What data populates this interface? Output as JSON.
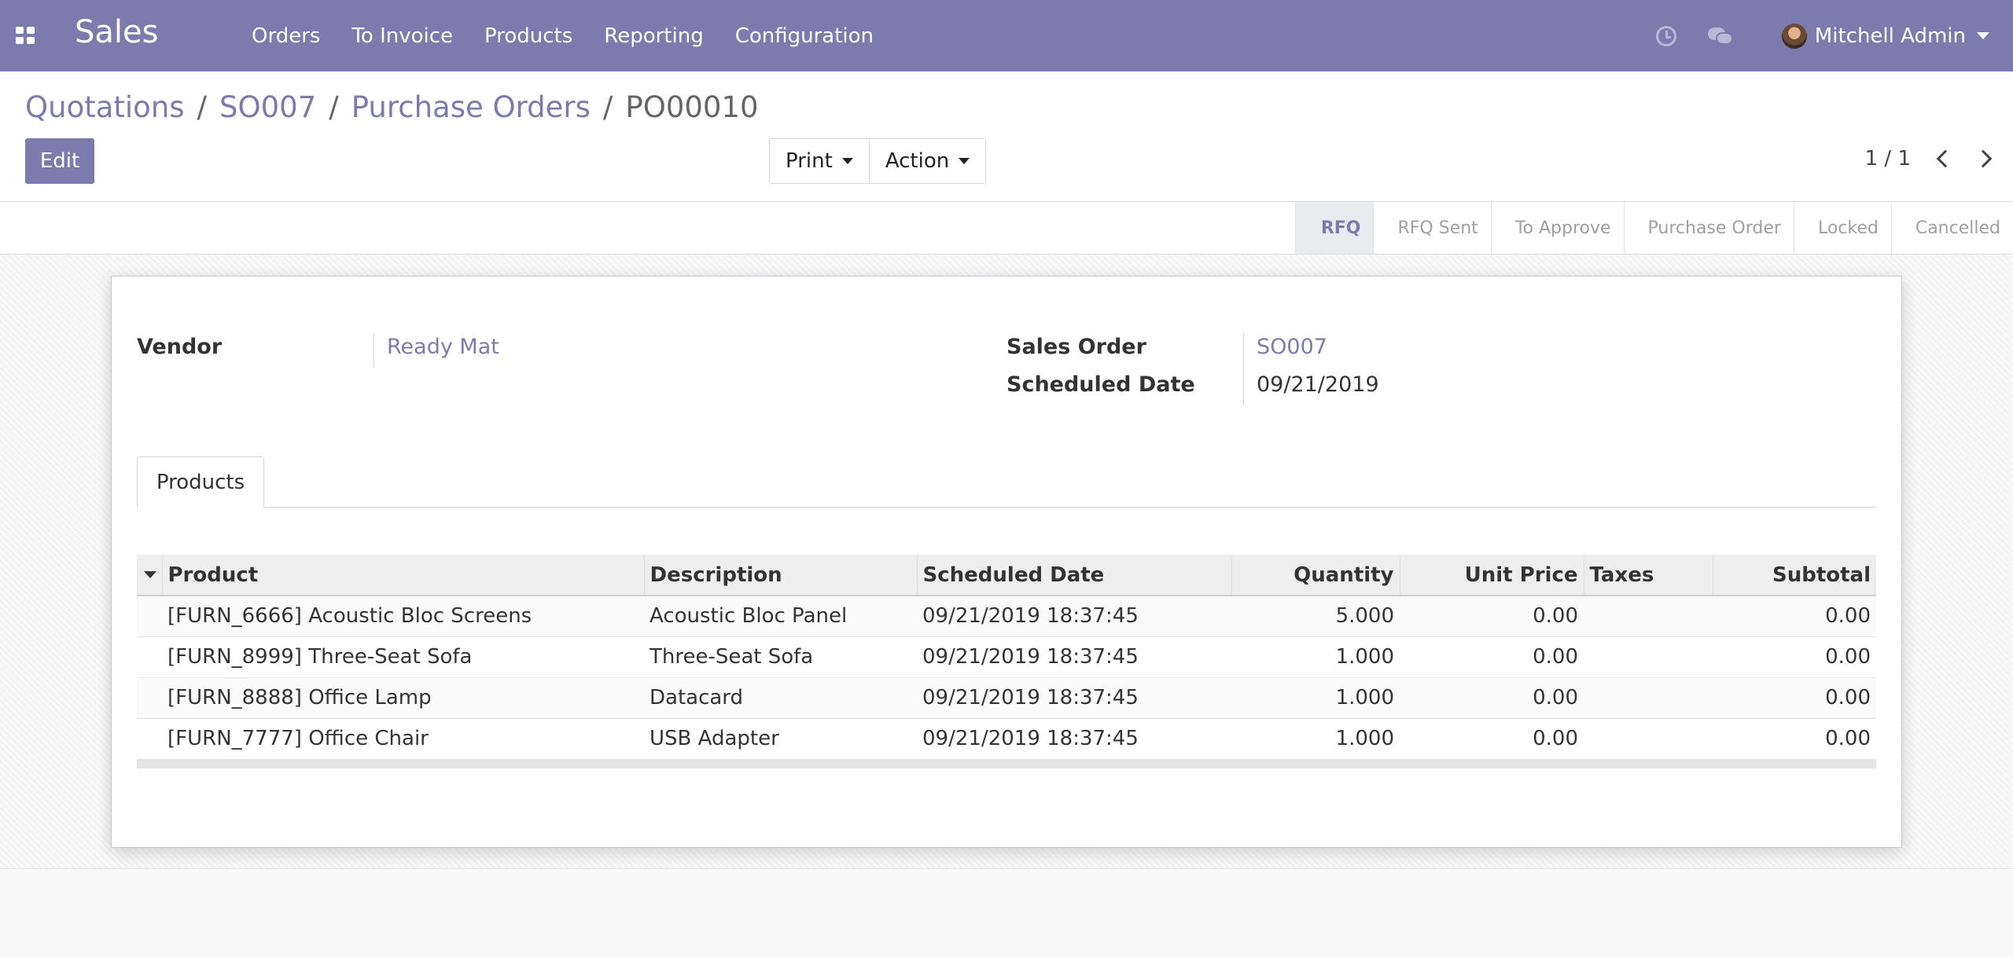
{
  "navbar": {
    "app_name": "Sales",
    "menu": [
      "Orders",
      "To Invoice",
      "Products",
      "Reporting",
      "Configuration"
    ],
    "user_name": "Mitchell Admin"
  },
  "breadcrumb": {
    "items": [
      "Quotations",
      "SO007",
      "Purchase Orders"
    ],
    "current": "PO00010"
  },
  "toolbar": {
    "edit_label": "Edit",
    "print_label": "Print",
    "action_label": "Action"
  },
  "pager": {
    "value": "1 / 1"
  },
  "status": {
    "stages": [
      "RFQ",
      "RFQ Sent",
      "To Approve",
      "Purchase Order",
      "Locked",
      "Cancelled"
    ],
    "active": "RFQ"
  },
  "form": {
    "vendor_label": "Vendor",
    "vendor_value": "Ready Mat",
    "sales_order_label": "Sales Order",
    "sales_order_value": "SO007",
    "scheduled_date_label": "Scheduled Date",
    "scheduled_date_value": "09/21/2019"
  },
  "tabs": {
    "products": "Products"
  },
  "table": {
    "headers": {
      "product": "Product",
      "description": "Description",
      "scheduled_date": "Scheduled Date",
      "quantity": "Quantity",
      "unit_price": "Unit Price",
      "taxes": "Taxes",
      "subtotal": "Subtotal"
    },
    "rows": [
      {
        "product": "[FURN_6666] Acoustic Bloc Screens",
        "description": "Acoustic Bloc Panel",
        "scheduled_date": "09/21/2019 18:37:45",
        "quantity": "5.000",
        "unit_price": "0.00",
        "taxes": "",
        "subtotal": "0.00"
      },
      {
        "product": "[FURN_8999] Three-Seat Sofa",
        "description": "Three-Seat Sofa",
        "scheduled_date": "09/21/2019 18:37:45",
        "quantity": "1.000",
        "unit_price": "0.00",
        "taxes": "",
        "subtotal": "0.00"
      },
      {
        "product": "[FURN_8888] Office Lamp",
        "description": "Datacard",
        "scheduled_date": "09/21/2019 18:37:45",
        "quantity": "1.000",
        "unit_price": "0.00",
        "taxes": "",
        "subtotal": "0.00"
      },
      {
        "product": "[FURN_7777] Office Chair",
        "description": "USB Adapter",
        "scheduled_date": "09/21/2019 18:37:45",
        "quantity": "1.000",
        "unit_price": "0.00",
        "taxes": "",
        "subtotal": "0.00"
      }
    ]
  },
  "colors": {
    "brand": "#7c7bad",
    "link": "#7c7bad"
  },
  "icons": [
    "apps-grid-icon",
    "clock-icon",
    "chat-icon",
    "chevron-down-icon",
    "chevron-left-icon",
    "chevron-right-icon"
  ]
}
